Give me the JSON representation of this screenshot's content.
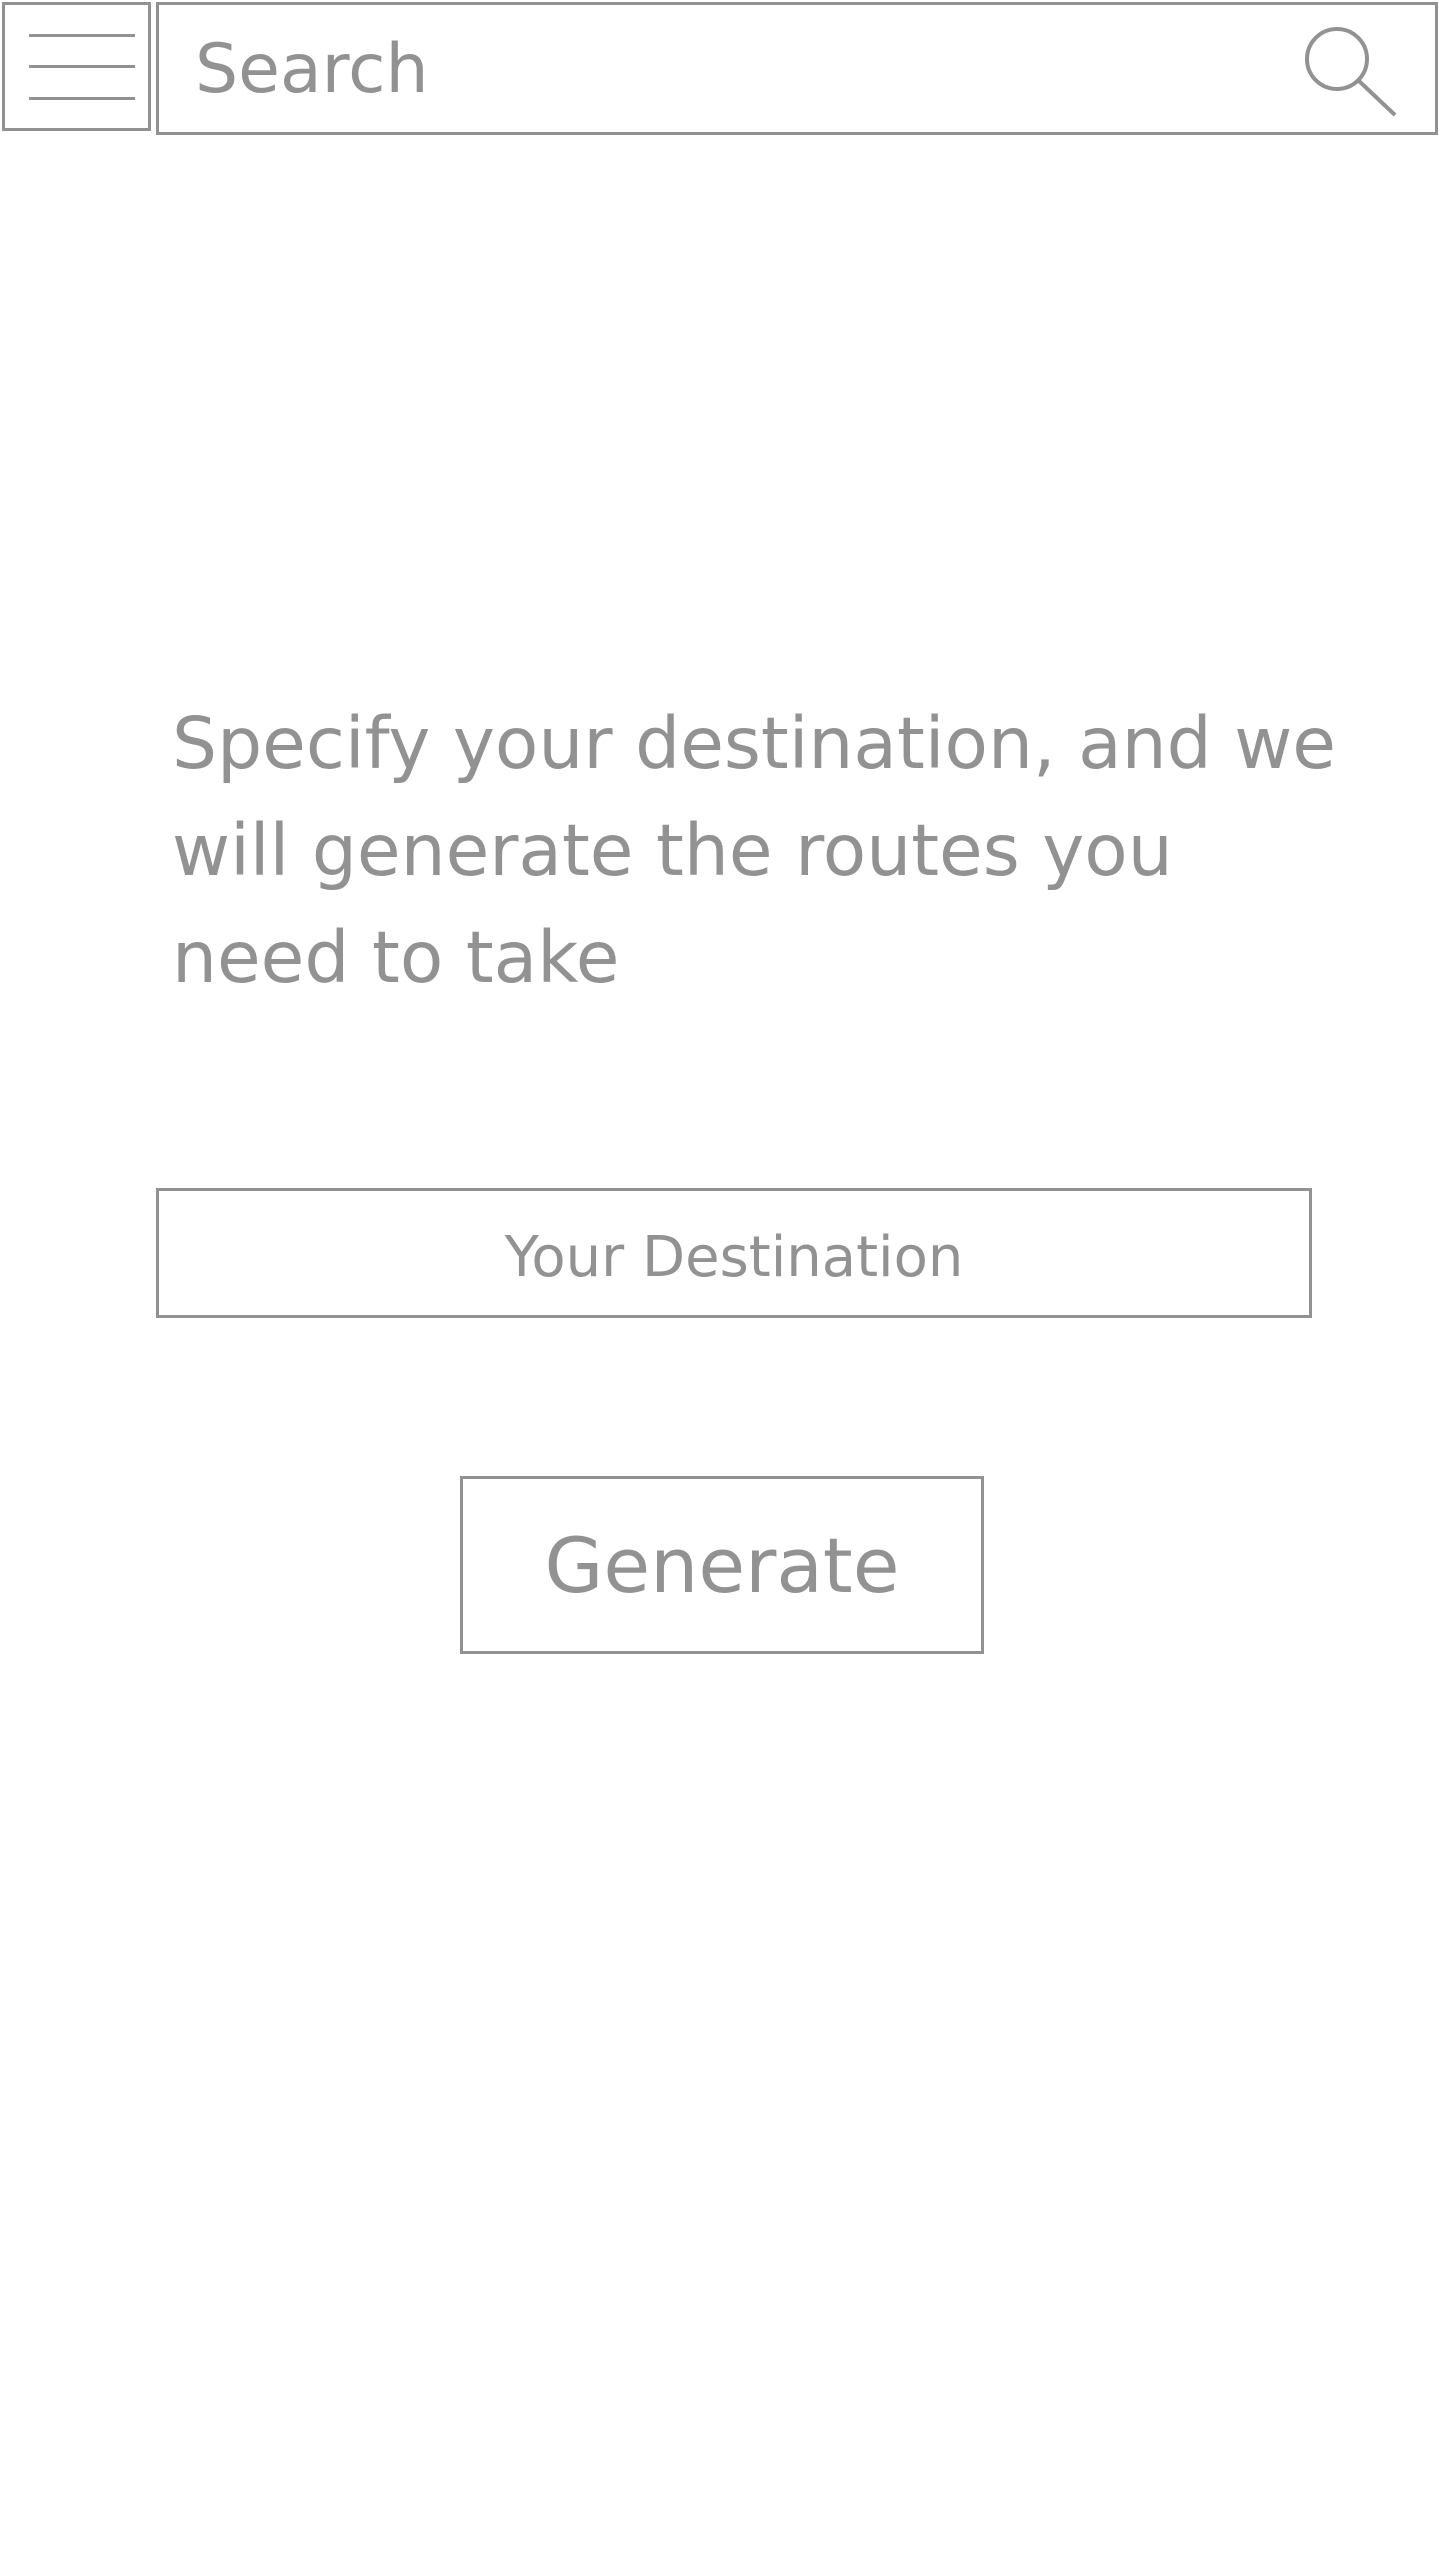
{
  "header": {
    "menu_icon": "hamburger-menu-icon",
    "search": {
      "placeholder": "Search",
      "icon": "search-icon"
    }
  },
  "main": {
    "intro_text": "Specify your destination, and we will generate the routes you need to take",
    "destination": {
      "placeholder": "Your Destination"
    },
    "generate_label": "Generate"
  },
  "colors": {
    "stroke": "#929292",
    "text": "#929292",
    "background": "#ffffff"
  }
}
